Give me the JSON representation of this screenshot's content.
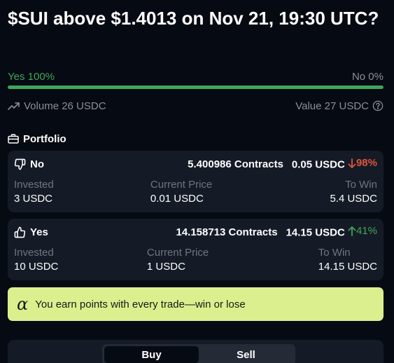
{
  "market": {
    "title": "$SUI above $1.4013 on Nov 21, 19:30 UTC?"
  },
  "odds": {
    "yes_label": "Yes 100%",
    "no_label": "No 0%",
    "yes_fraction": 1.0
  },
  "stats": {
    "volume_label": "Volume 26 USDC",
    "value_label": "Value 27 USDC"
  },
  "portfolio": {
    "heading": "Portfolio",
    "positions": [
      {
        "side": "No",
        "contracts": "5.400986 Contracts",
        "value": "0.05 USDC",
        "change": "98%",
        "change_direction": "down",
        "invested_label": "Invested",
        "invested": "3 USDC",
        "current_price_label": "Current Price",
        "current_price": "0.01 USDC",
        "to_win_label": "To Win",
        "to_win": "5.4 USDC"
      },
      {
        "side": "Yes",
        "contracts": "14.158713 Contracts",
        "value": "14.15 USDC",
        "change": "41%",
        "change_direction": "up",
        "invested_label": "Invested",
        "invested": "10 USDC",
        "current_price_label": "Current Price",
        "current_price": "1 USDC",
        "to_win_label": "To Win",
        "to_win": "14.15 USDC"
      }
    ]
  },
  "banner": {
    "symbol": "α",
    "text": "You earn points with every trade—win or lose"
  },
  "trade": {
    "tabs": [
      {
        "label": "Buy",
        "active": true
      },
      {
        "label": "Sell",
        "active": false
      }
    ]
  },
  "colors": {
    "background": "#060a12",
    "card": "#151b26",
    "green": "#3fa55c",
    "red": "#e0533d",
    "banner": "#dcef8f"
  },
  "icons": {
    "volume": "trending-up-icon",
    "value_info": "help-circle-icon",
    "portfolio": "briefcase-icon",
    "no_side": "thumbs-down-icon",
    "yes_side": "thumbs-up-icon",
    "down": "arrow-down-icon",
    "up": "arrow-up-icon"
  }
}
